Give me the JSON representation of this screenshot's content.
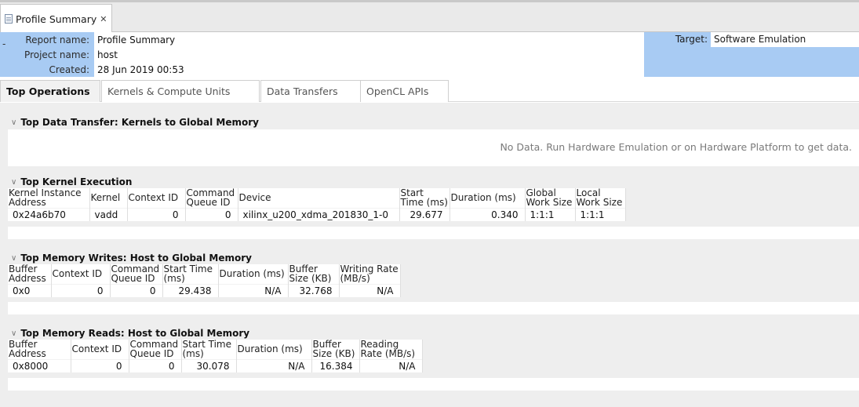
{
  "editor_tab": {
    "label": "Profile Summary",
    "close_glyph": "✕"
  },
  "header": {
    "collapse_glyph": "-",
    "report_name_label": "Report name:",
    "report_name": "Profile Summary",
    "project_name_label": "Project name:",
    "project_name": "host",
    "created_label": "Created:",
    "created": "28 Jun 2019 00:53",
    "target_label": "Target:",
    "target": "Software Emulation"
  },
  "tabs": [
    {
      "label": "Top Operations",
      "active": true
    },
    {
      "label": "Kernels & Compute Units"
    },
    {
      "label": "Data Transfers"
    },
    {
      "label": "OpenCL APIs"
    }
  ],
  "sections": {
    "data_transfer": {
      "title": "Top Data Transfer: Kernels to Global Memory",
      "no_data": "No Data. Run Hardware Emulation or on Hardware Platform to get data."
    },
    "kernel_exec": {
      "title": "Top Kernel Execution",
      "headers": [
        "Kernel Instance Address",
        "Kernel",
        "Context ID",
        "Command Queue ID",
        "Device",
        "Start Time (ms)",
        "Duration (ms)",
        "Global Work Size",
        "Local Work Size"
      ],
      "rows": [
        [
          "0x24a6b70",
          "vadd",
          "0",
          "0",
          "xilinx_u200_xdma_201830_1-0",
          "29.677",
          "0.340",
          "1:1:1",
          "1:1:1"
        ]
      ]
    },
    "mem_writes": {
      "title": "Top Memory Writes: Host to Global Memory",
      "headers": [
        "Buffer Address",
        "Context ID",
        "Command Queue ID",
        "Start Time (ms)",
        "Duration (ms)",
        "Buffer Size (KB)",
        "Writing Rate (MB/s)"
      ],
      "rows": [
        [
          "0x0",
          "0",
          "0",
          "29.438",
          "N/A",
          "32.768",
          "N/A"
        ]
      ]
    },
    "mem_reads": {
      "title": "Top Memory Reads: Host to Global Memory",
      "headers": [
        "Buffer Address",
        "Context ID",
        "Command Queue ID",
        "Start Time (ms)",
        "Duration (ms)",
        "Buffer Size (KB)",
        "Reading Rate (MB/s)"
      ],
      "rows": [
        [
          "0x8000",
          "0",
          "0",
          "30.078",
          "N/A",
          "16.384",
          "N/A"
        ]
      ]
    }
  },
  "colors": {
    "header_blue": "#a8cbf3",
    "content_bg": "#eeeeee"
  }
}
